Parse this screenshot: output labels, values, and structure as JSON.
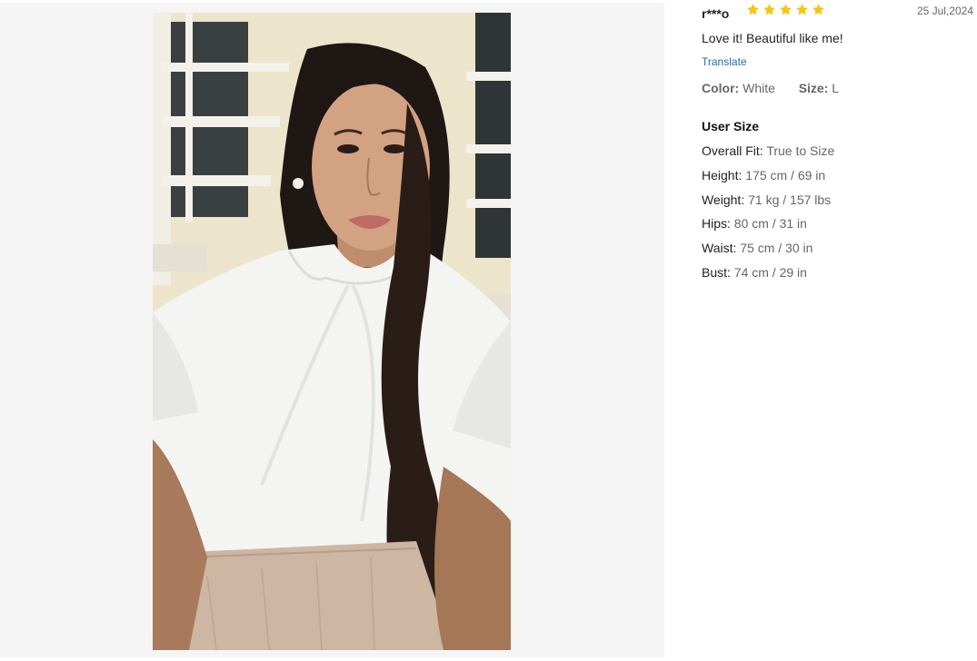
{
  "review": {
    "reviewer": "r***o",
    "rating": 5,
    "date": "25 Jul,2024",
    "comment": "Love it! Beautiful like me!",
    "translate_label": "Translate",
    "color_label": "Color:",
    "color_value": "White",
    "size_label": "Size:",
    "size_value": "L",
    "user_size_title": "User Size",
    "metrics": [
      {
        "label": "Overall Fit:",
        "value": "True to Size"
      },
      {
        "label": "Height:",
        "value": "175 cm / 69 in"
      },
      {
        "label": "Weight:",
        "value": "71 kg / 157 lbs"
      },
      {
        "label": "Hips:",
        "value": "80 cm / 31 in"
      },
      {
        "label": "Waist:",
        "value": "75 cm / 30 in"
      },
      {
        "label": "Bust:",
        "value": "74 cm / 29 in"
      }
    ]
  },
  "colors": {
    "star": "#f5c518",
    "link": "#2d68a8",
    "panel_bg": "#f5f5f5"
  },
  "icons": {
    "rating_star": "star-icon"
  }
}
